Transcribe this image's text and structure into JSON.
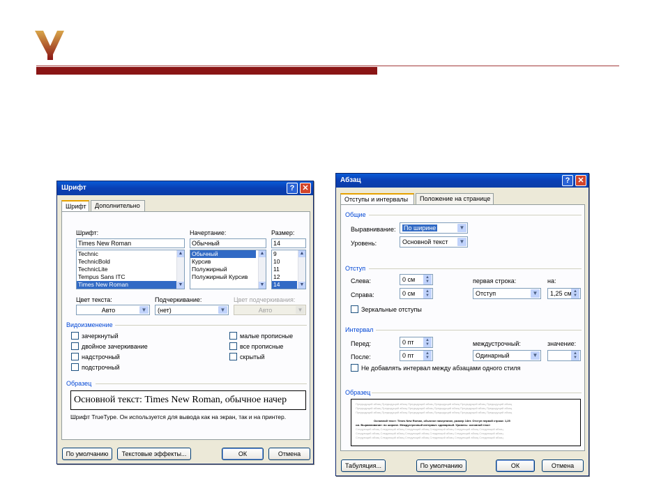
{
  "colors": {
    "brand_red": "#8a1515",
    "titlebar": "#0a3fb4",
    "selection": "#316ac5",
    "group_label": "#0046d5"
  },
  "font_dialog": {
    "title": "Шрифт",
    "help_glyph": "?",
    "close_glyph": "✕",
    "tabs": [
      "Шрифт",
      "Дополнительно"
    ],
    "font_label": "Шрифт:",
    "font_value": "Times New Roman",
    "font_list": [
      "Technic",
      "TechnicBold",
      "TechnicLite",
      "Tempus Sans ITC",
      "Times New Roman"
    ],
    "style_label": "Начертание:",
    "style_value": "Обычный",
    "style_list": [
      "Обычный",
      "Курсив",
      "Полужирный",
      "Полужирный Курсив"
    ],
    "size_label": "Размер:",
    "size_value": "14",
    "size_list": [
      "9",
      "10",
      "11",
      "12",
      "14"
    ],
    "color_label": "Цвет текста:",
    "color_value": "Авто",
    "underline_label": "Подчеркивание:",
    "underline_value": "(нет)",
    "underline_color_label": "Цвет подчеркивания:",
    "underline_color_value": "Авто",
    "modification_group": "Видоизменение",
    "effects_left": [
      "зачеркнутый",
      "двойное зачеркивание",
      "надстрочный",
      "подстрочный"
    ],
    "effects_right": [
      "малые прописные",
      "все прописные",
      "скрытый"
    ],
    "sample_group": "Образец",
    "sample_text": "Основной текст: Times New Roman, обычное начер",
    "truetype_note": "Шрифт TrueType. Он используется для вывода как на экран, так и на принтер.",
    "btn_default": "По умолчанию",
    "btn_effects": "Текстовые эффекты...",
    "btn_ok": "ОК",
    "btn_cancel": "Отмена"
  },
  "para_dialog": {
    "title": "Абзац",
    "help_glyph": "?",
    "close_glyph": "✕",
    "tabs": [
      "Отступы и интервалы",
      "Положение на странице"
    ],
    "general_group": "Общие",
    "align_label": "Выравнивание:",
    "align_value": "По ширине",
    "level_label": "Уровень:",
    "level_value": "Основной текст",
    "indent_group": "Отступ",
    "left_label": "Слева:",
    "left_value": "0 см",
    "right_label": "Справа:",
    "right_value": "0 см",
    "first_line_label": "первая строка:",
    "first_line_value": "Отступ",
    "by_label": "на:",
    "by_value": "1,25 см",
    "mirror_label": "Зеркальные отступы",
    "spacing_group": "Интервал",
    "before_label": "Перед:",
    "before_value": "0 пт",
    "after_label": "После:",
    "after_value": "0 пт",
    "line_spacing_label": "междустрочный:",
    "line_spacing_value": "Одинарный",
    "value_label": "значение:",
    "value_value": "",
    "no_space_label": "Не добавлять интервал между абзацами одного стиля",
    "sample_group": "Образец",
    "preview_prev": "Предыдущий абзац Предыдущий абзац Предыдущий абзац Предыдущий абзац Предыдущий абзац Предыдущий абзац",
    "preview_main_1": "Основной текст: Times New Roman, обычное начертание, размер 14пт. Отступ первой строки: 1,25",
    "preview_main_2": "см. Выравнивание: по ширине. Междустрочный интервал: одинарный. Уровень: основной текст",
    "preview_next": "Следующий абзац Следующий абзац Следующий абзац Следующий абзац Следующий абзац Следующий абзац",
    "btn_tabs": "Табуляция...",
    "btn_default": "По умолчанию",
    "btn_ok": "ОК",
    "btn_cancel": "Отмена"
  }
}
